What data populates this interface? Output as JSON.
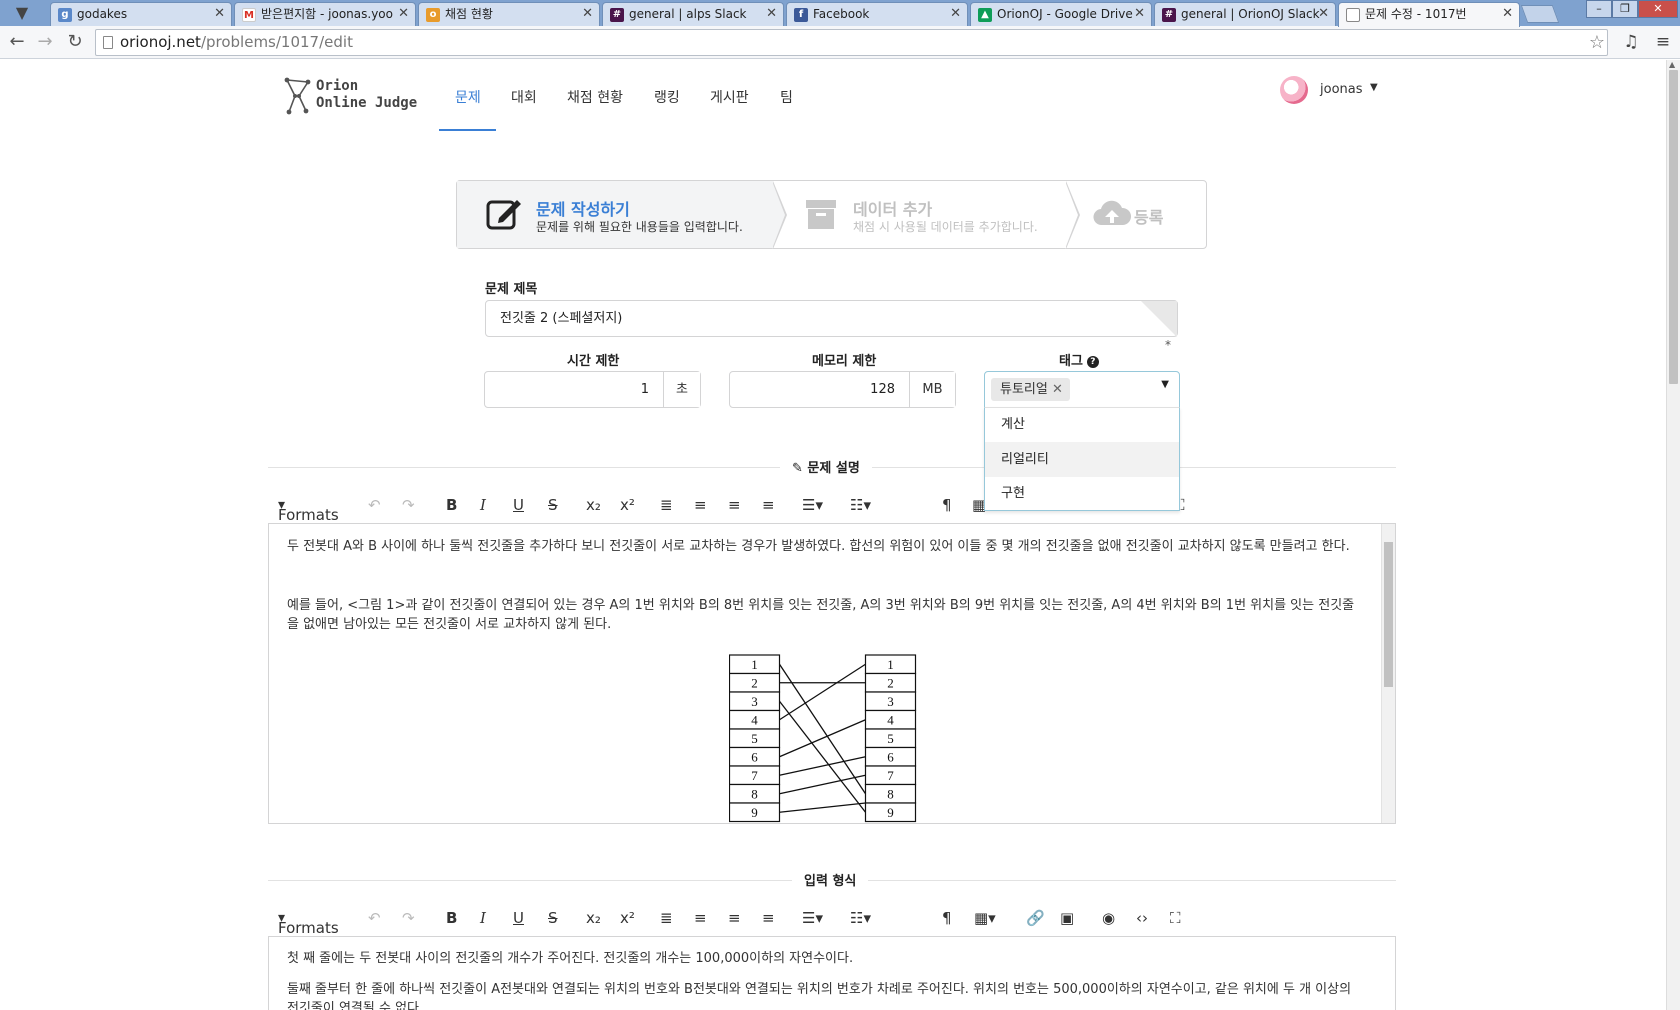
{
  "browser": {
    "tabs": [
      {
        "title": "godakes",
        "icon": "incognito-icon",
        "color": "#5a88c9"
      },
      {
        "title": "받은편지함 - joonas.yoo",
        "icon": "gmail-icon",
        "color": "#d93025"
      },
      {
        "title": "채점 현황",
        "icon": "orion-icon",
        "color": "#e89b2b"
      },
      {
        "title": "general | alps Slack",
        "icon": "slack-icon",
        "color": "#4a154b"
      },
      {
        "title": "Facebook",
        "icon": "facebook-icon",
        "color": "#3b5998"
      },
      {
        "title": "OrionOJ - Google Drive",
        "icon": "drive-icon",
        "color": "#0f9d58"
      },
      {
        "title": "general | OrionOJ Slack",
        "icon": "slack-icon",
        "color": "#4a154b"
      },
      {
        "title": "문제 수정 - 1017번",
        "icon": "page-icon",
        "color": "#888888"
      }
    ],
    "url_host": "orionoj.net",
    "url_path": "/problems/1017/edit"
  },
  "header": {
    "logo_line1": "Orion",
    "logo_line2": "Online Judge",
    "nav": [
      "문제",
      "대회",
      "채점 현황",
      "랭킹",
      "게시판",
      "팀"
    ],
    "active_nav": "문제",
    "username": "joonas"
  },
  "steps": [
    {
      "title": "문제 작성하기",
      "desc": "문제를 위해 필요한 내용들을 입력합니다.",
      "state": "active"
    },
    {
      "title": "데이터 추가",
      "desc": "채점 시 사용될 데이터를 추가합니다.",
      "state": "disabled"
    },
    {
      "title": "등록",
      "desc": "",
      "state": "disabled"
    }
  ],
  "form": {
    "title_label": "문제 제목",
    "title_value": "전깃줄 2 (스페셜저지)",
    "required_mark": "*",
    "time_label": "시간 제한",
    "time_value": "1",
    "time_unit": "초",
    "memory_label": "메모리 제한",
    "memory_value": "128",
    "memory_unit": "MB",
    "tag_label": "태그",
    "selected_tag": "튜토리얼",
    "tag_options": [
      "계산",
      "리얼리티",
      "구현"
    ],
    "hovered_tag_option": "리얼리티"
  },
  "sections": {
    "description_label": "문제 설명",
    "input_label": "입력 형식",
    "formats_label": "Formats"
  },
  "description": {
    "paragraph1": "두 전봇대 A와 B 사이에 하나 둘씩 전깃줄을 추가하다 보니 전깃줄이 서로 교차하는 경우가 발생하였다. 합선의 위험이 있어 이들 중 몇 개의 전깃줄을 없애 전깃줄이 교차하지 않도록 만들려고 한다.",
    "paragraph2": "예를 들어, <그림 1>과 같이 전깃줄이 연결되어 있는 경우 A의 1번 위치와 B의 8번 위치를 잇는 전깃줄, A의 3번 위치와 B의 9번 위치를 잇는 전깃줄, A의 4번 위치와 B의 1번 위치를 잇는 전깃줄을 없애면 남아있는 모든 전깃줄이 서로 교차하지 않게 된다.",
    "figure_rows": [
      "1",
      "2",
      "3",
      "4",
      "5",
      "6",
      "7",
      "8",
      "9"
    ]
  },
  "input_format": {
    "paragraph1": "첫 째 줄에는 두 전봇대 사이의 전깃줄의 개수가 주어진다. 전깃줄의 개수는 100,000이하의 자연수이다.",
    "paragraph2": "둘째 줄부터 한 줄에 하나씩 전깃줄이 A전봇대와 연결되는 위치의 번호와 B전봇대와 연결되는 위치의 번호가 차례로 주어진다. 위치의 번호는 500,000이하의 자연수이고, 같은 위치에 두 개 이상의 전깃줄이 연결될 수 없다."
  }
}
